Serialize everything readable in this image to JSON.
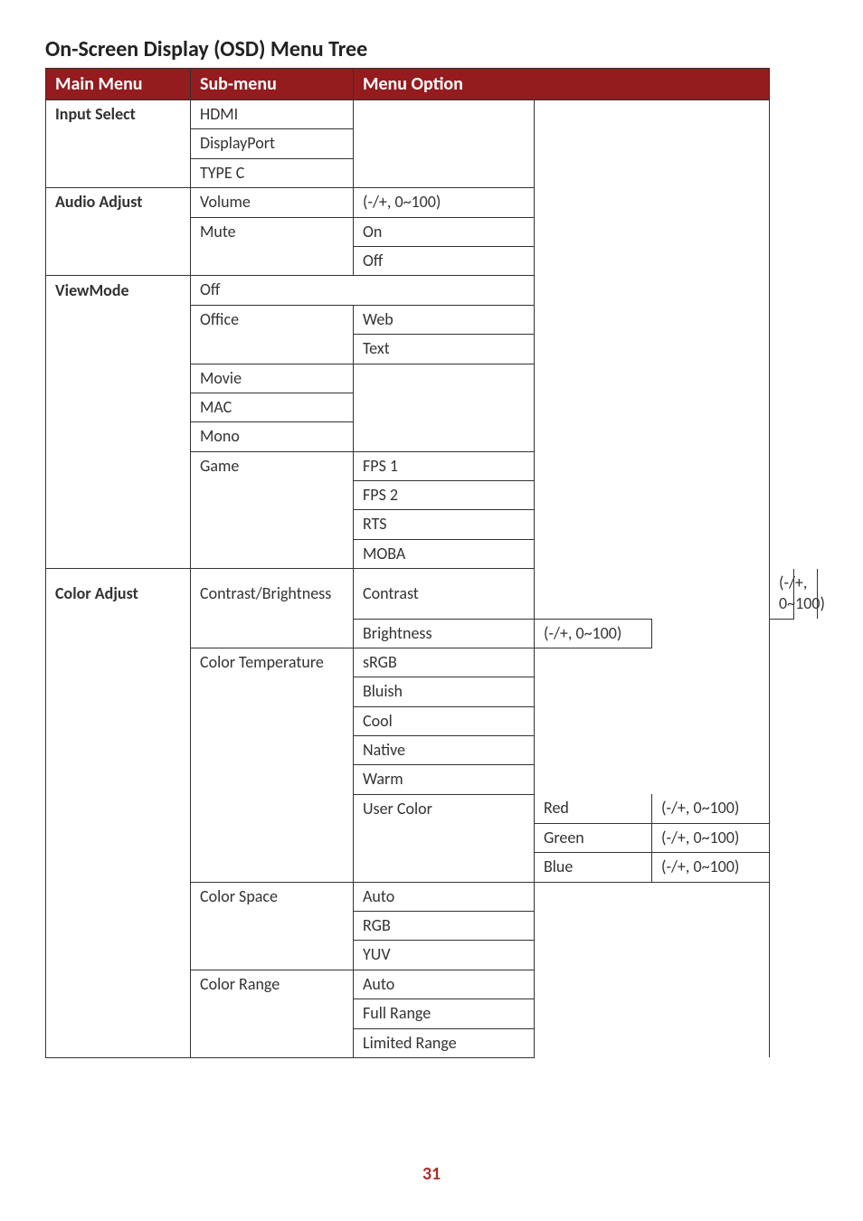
{
  "title": "On-Screen Display (OSD) Menu Tree",
  "headers": {
    "main": "Main Menu",
    "sub": "Sub-menu",
    "option": "Menu Option"
  },
  "range": "(-/+, 0~100)",
  "input_select": {
    "label": "Input Select",
    "items": [
      "HDMI",
      "DisplayPort",
      "TYPE C"
    ]
  },
  "audio_adjust": {
    "label": "Audio Adjust",
    "volume": "Volume",
    "mute": "Mute",
    "on": "On",
    "off": "Off"
  },
  "viewmode": {
    "label": "ViewMode",
    "off": "Off",
    "office": "Office",
    "web": "Web",
    "text": "Text",
    "movie": "Movie",
    "mac": "MAC",
    "mono": "Mono",
    "game": "Game",
    "fps1": "FPS 1",
    "fps2": "FPS 2",
    "rts": "RTS",
    "moba": "MOBA"
  },
  "color_adjust": {
    "label": "Color Adjust",
    "cb": "Contrast/Brightness",
    "contrast": "Contrast",
    "brightness": "Brightness",
    "ct": "Color Temperature",
    "srgb": "sRGB",
    "bluish": "Bluish",
    "cool": "Cool",
    "native": "Native",
    "warm": "Warm",
    "usercolor": "User Color",
    "red": "Red",
    "green": "Green",
    "blue": "Blue",
    "cs": "Color Space",
    "auto": "Auto",
    "rgb": "RGB",
    "yuv": "YUV",
    "cr": "Color Range",
    "full": "Full Range",
    "limited": "Limited Range"
  },
  "page": "31"
}
